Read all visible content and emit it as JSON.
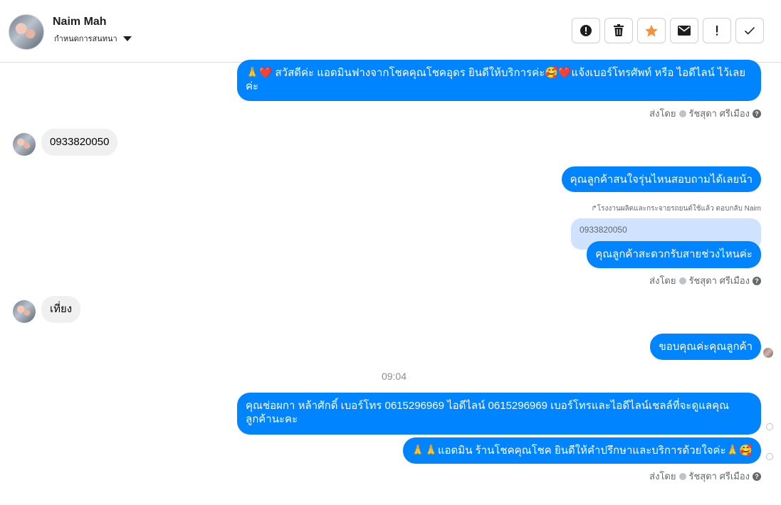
{
  "header": {
    "name": "Naim Mah",
    "assign_label": "กำหนดการสนทนา",
    "tools": [
      "alert-icon",
      "trash-icon",
      "star-icon",
      "mail-icon",
      "exclamation-icon",
      "check-icon"
    ],
    "star_color": "#f7923b"
  },
  "colors": {
    "outgoing": "#0084ff",
    "incoming": "#f0f0f0",
    "quoted": "#cfe3ff"
  },
  "messages": {
    "m1": "🙏❤️ สวัสดีค่ะ แอดมินฟางจากโชคคุณโชคอุดร ยินดีให้บริการค่ะ🥰❤️แจ้งเบอร์โทรศัพท์ หรือ ไอดีไลน์  ไว้เลยค่ะ",
    "m2": "0933820050",
    "m3": "คุณลูกค้าสนใจรุ่นไหนสอบถามได้เลยน้า",
    "reply_note": "↱โรงงานผลิตและกระจายรถยนต์ใช้แล้ว ตอบกลับ Naim",
    "quoted": "0933820050",
    "m4": "คุณลูกค้าสะดวกรับสายช่วงไหนค่ะ",
    "m5": "เที่ยง",
    "m6": "ขอบคุณค่ะคุณลูกค้า",
    "time": "09:04",
    "m7": "คุณช่อผกา หล้าศักดิ์       เบอร์โทร 0615296969  ไอดีไลน์ 0615296969   เบอร์โทรและไอดีไลน์เชลล์ที่จะดูแลคุณลูกค้านะคะ",
    "m8": "🙏🙏แอดมิน ร้านโชคคุณโชค ยินดีให้คำปรึกษาและบริการด้วยใจค่ะ🙏🥰"
  },
  "sent_by": {
    "prefix": "ส่งโดย",
    "name": "รัชสุดา ศรีเมือง",
    "help": "?"
  }
}
